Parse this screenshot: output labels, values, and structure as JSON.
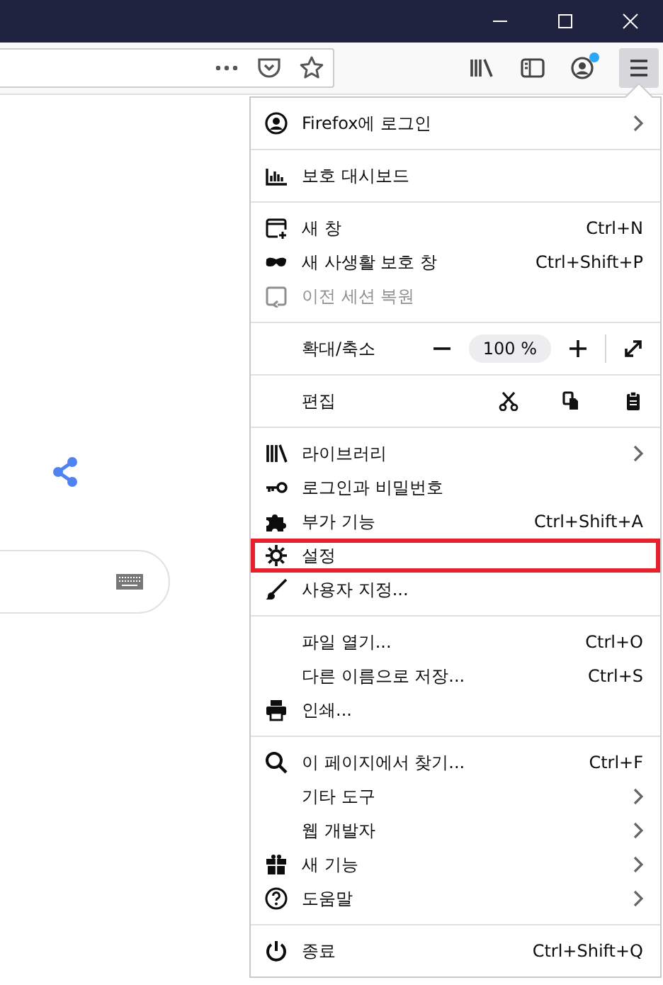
{
  "toolbar": {
    "account_notification": true
  },
  "menu": {
    "sections": [
      [
        {
          "label": "Firefox에 로그인",
          "submenu": true,
          "disabled": false,
          "highlighted": false
        }
      ],
      [
        {
          "label": "보호 대시보드",
          "submenu": false,
          "disabled": false,
          "highlighted": false
        }
      ],
      [
        {
          "label": "새 창",
          "shortcut": "Ctrl+N",
          "submenu": false,
          "disabled": false,
          "highlighted": false
        },
        {
          "label": "새 사생활 보호 창",
          "shortcut": "Ctrl+Shift+P",
          "submenu": false,
          "disabled": false,
          "highlighted": false
        },
        {
          "label": "이전 세션 복원",
          "submenu": false,
          "disabled": true,
          "highlighted": false
        }
      ],
      [
        {
          "kind": "zoom",
          "label": "확대/축소",
          "value": "100 %"
        }
      ],
      [
        {
          "kind": "edit",
          "label": "편집"
        }
      ],
      [
        {
          "label": "라이브러리",
          "submenu": true,
          "disabled": false,
          "highlighted": false
        },
        {
          "label": "로그인과 비밀번호",
          "submenu": false,
          "disabled": false,
          "highlighted": false
        },
        {
          "label": "부가 기능",
          "shortcut": "Ctrl+Shift+A",
          "submenu": false,
          "disabled": false,
          "highlighted": false
        },
        {
          "label": "설정",
          "submenu": false,
          "disabled": false,
          "highlighted": true
        },
        {
          "label": "사용자 지정...",
          "submenu": false,
          "disabled": false,
          "highlighted": false
        }
      ],
      [
        {
          "label": "파일 열기...",
          "shortcut": "Ctrl+O",
          "submenu": false,
          "disabled": false,
          "highlighted": false
        },
        {
          "label": "다른 이름으로 저장...",
          "shortcut": "Ctrl+S",
          "submenu": false,
          "disabled": false,
          "highlighted": false
        },
        {
          "label": "인쇄...",
          "submenu": false,
          "disabled": false,
          "highlighted": false
        }
      ],
      [
        {
          "label": "이 페이지에서 찾기...",
          "shortcut": "Ctrl+F",
          "submenu": false,
          "disabled": false,
          "highlighted": false
        },
        {
          "label": "기타 도구",
          "submenu": true,
          "disabled": false,
          "highlighted": false
        },
        {
          "label": "웹 개발자",
          "submenu": true,
          "disabled": false,
          "highlighted": false
        },
        {
          "label": "새 기능",
          "submenu": true,
          "disabled": false,
          "highlighted": false
        },
        {
          "label": "도움말",
          "submenu": true,
          "disabled": false,
          "highlighted": false
        }
      ],
      [
        {
          "label": "종료",
          "shortcut": "Ctrl+Shift+Q",
          "submenu": false,
          "disabled": false,
          "highlighted": false
        }
      ]
    ]
  }
}
